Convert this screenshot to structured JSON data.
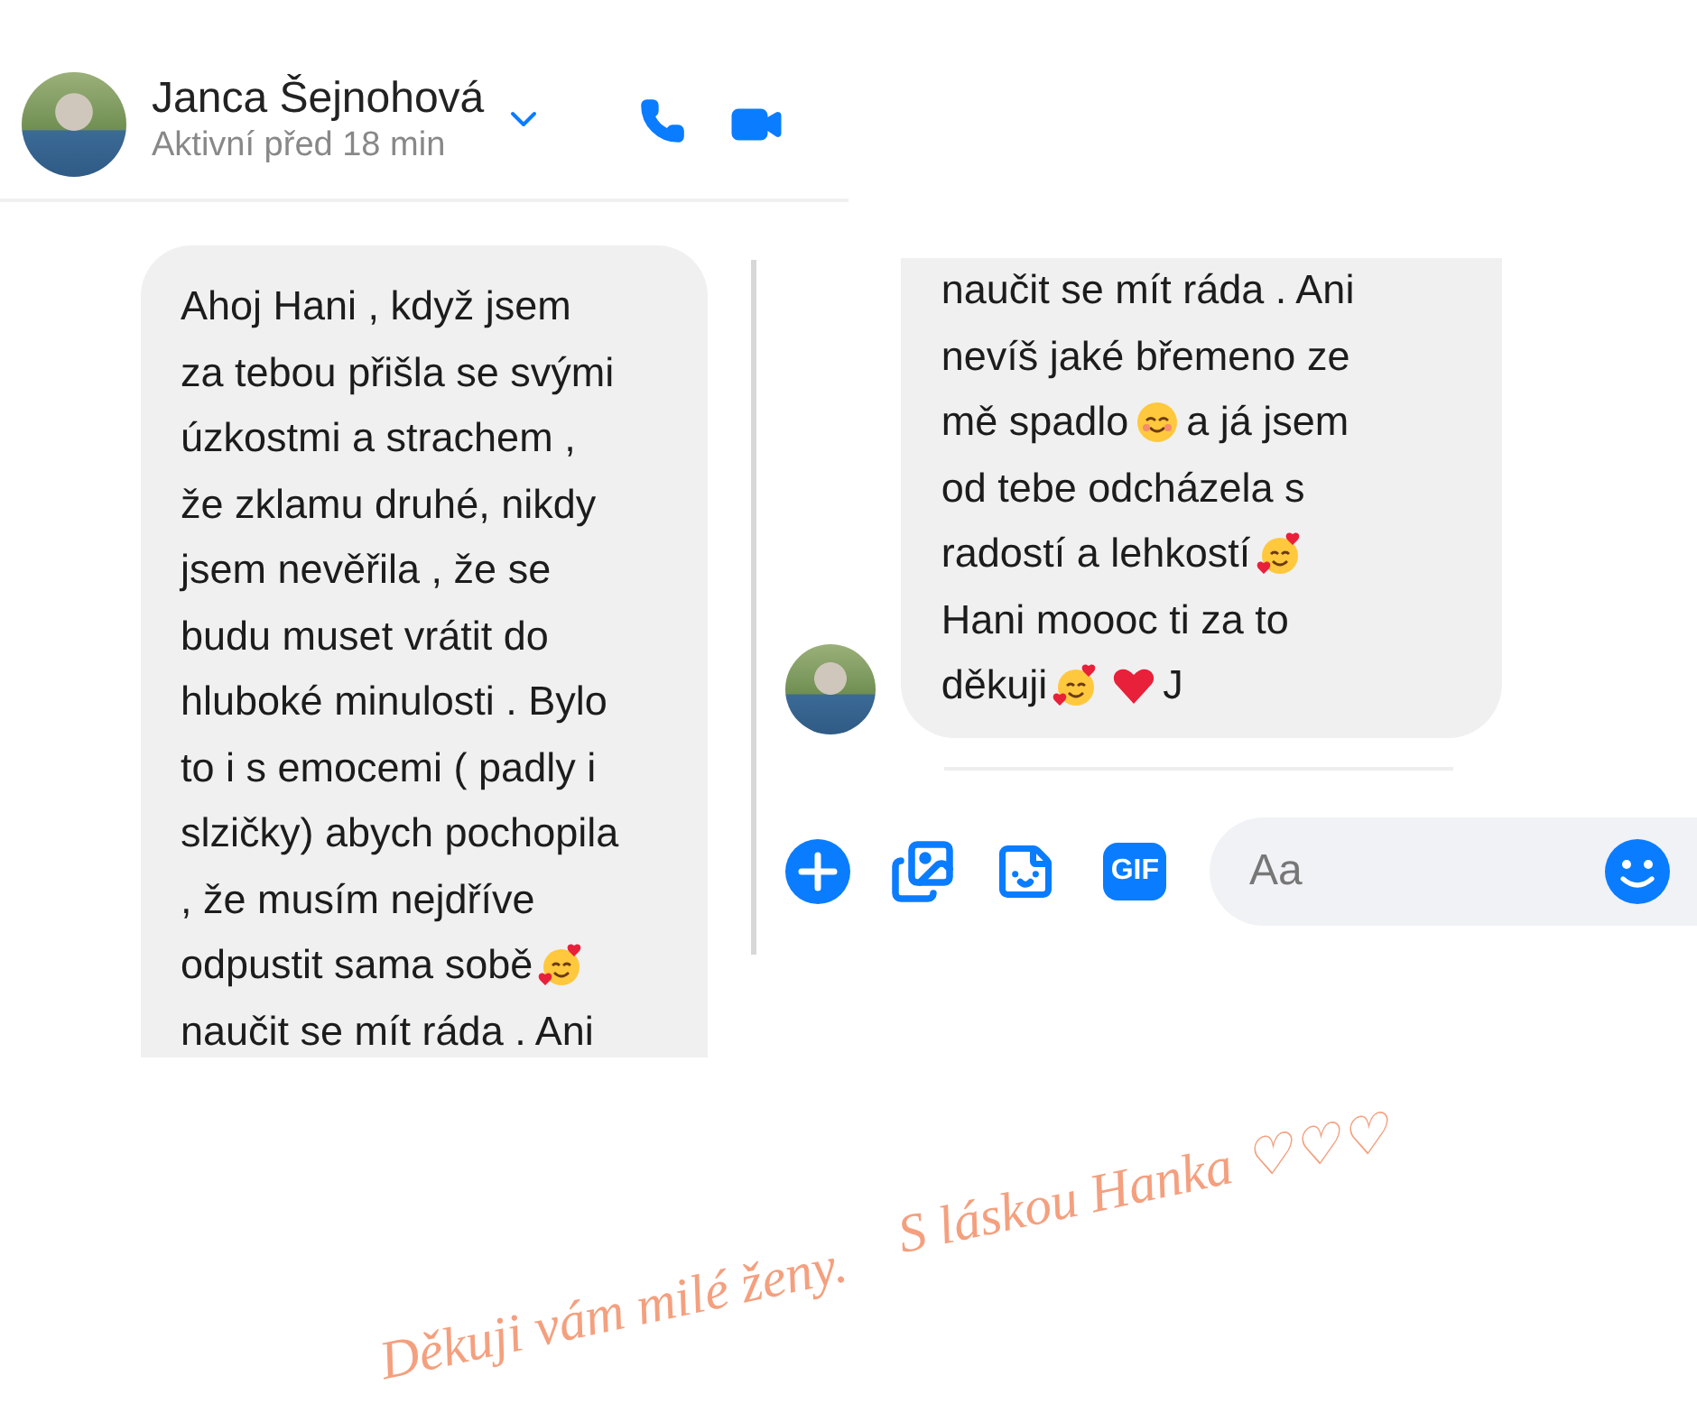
{
  "header": {
    "name": "Janca Šejnohová",
    "status": "Aktivní před 18 min"
  },
  "left_message": {
    "lines": [
      [
        {
          "kind": "text",
          "text": "Ahoj Hani , když jsem"
        }
      ],
      [
        {
          "kind": "text",
          "text": "za tebou přišla se svými"
        }
      ],
      [
        {
          "kind": "text",
          "text": "úzkostmi a strachem ,"
        }
      ],
      [
        {
          "kind": "text",
          "text": "že zklamu druhé, nikdy"
        }
      ],
      [
        {
          "kind": "text",
          "text": "jsem nevěřila , že se"
        }
      ],
      [
        {
          "kind": "text",
          "text": "budu muset vrátit do"
        }
      ],
      [
        {
          "kind": "text",
          "text": "hluboké minulosti . Bylo"
        }
      ],
      [
        {
          "kind": "text",
          "text": "to i s emocemi ( padly i"
        }
      ],
      [
        {
          "kind": "text",
          "text": "slzičky) abych pochopila"
        }
      ],
      [
        {
          "kind": "text",
          "text": ", že musím nejdříve"
        }
      ],
      [
        {
          "kind": "text",
          "text": "odpustit sama sobě"
        },
        {
          "kind": "hearts-face"
        }
      ],
      [
        {
          "kind": "text",
          "text": "naučit se mít ráda . Ani"
        }
      ]
    ]
  },
  "right_message": {
    "lines": [
      [
        {
          "kind": "text",
          "text": "naučit se mít ráda . Ani"
        }
      ],
      [
        {
          "kind": "text",
          "text": "nevíš jaké břemeno ze"
        }
      ],
      [
        {
          "kind": "text",
          "text": "mě spadlo"
        },
        {
          "kind": "smile-face"
        },
        {
          "kind": "text",
          "text": "a já jsem"
        }
      ],
      [
        {
          "kind": "text",
          "text": "od tebe odcházela s"
        }
      ],
      [
        {
          "kind": "text",
          "text": "radostí a lehkostí"
        },
        {
          "kind": "hearts-face"
        }
      ],
      [
        {
          "kind": "text",
          "text": "Hani moooc ti za to"
        }
      ],
      [
        {
          "kind": "text",
          "text": "děkuji"
        },
        {
          "kind": "hearts-face"
        },
        {
          "kind": "heart"
        },
        {
          "kind": "text",
          "text": "J"
        }
      ]
    ]
  },
  "composer": {
    "gif_label": "GIF",
    "placeholder": "Aa"
  },
  "signature": [
    "Děkuji vám milé ženy.",
    "S láskou Hanka ♡♡♡"
  ]
}
